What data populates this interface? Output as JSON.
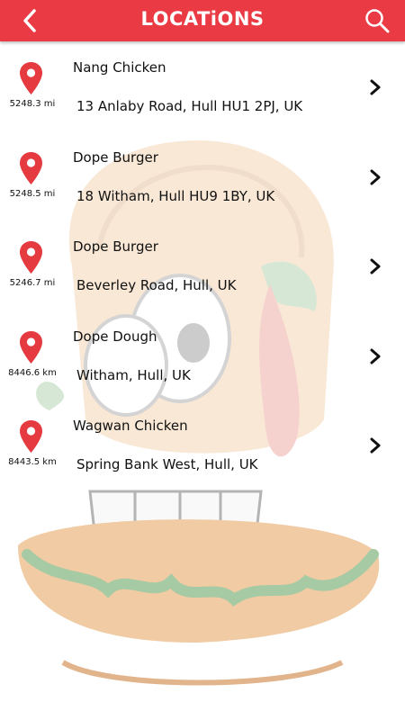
{
  "header": {
    "title": "LOCATiONS",
    "bar_color": "#ea3b45"
  },
  "locations": [
    {
      "name": "Nang Chicken",
      "address": "13 Anlaby Road, Hull HU1 2PJ, UK",
      "distance": "5248.3 mi"
    },
    {
      "name": "Dope Burger",
      "address": "18 Witham, Hull HU9 1BY, UK",
      "distance": "5248.5 mi"
    },
    {
      "name": "Dope Burger",
      "address": "Beverley Road, Hull, UK",
      "distance": "5246.7 mi"
    },
    {
      "name": "Dope Dough",
      "address": "Witham, Hull, UK",
      "distance": "8446.6 km"
    },
    {
      "name": "Wagwan Chicken",
      "address": "Spring Bank West, Hull, UK",
      "distance": "8443.5 km"
    }
  ],
  "icons": {
    "back": "chevron-left-icon",
    "search": "search-icon",
    "pin": "map-pin-icon",
    "row_arrow": "chevron-right-icon"
  },
  "colors": {
    "accent": "#ea3b45",
    "pin": "#e53a40"
  }
}
